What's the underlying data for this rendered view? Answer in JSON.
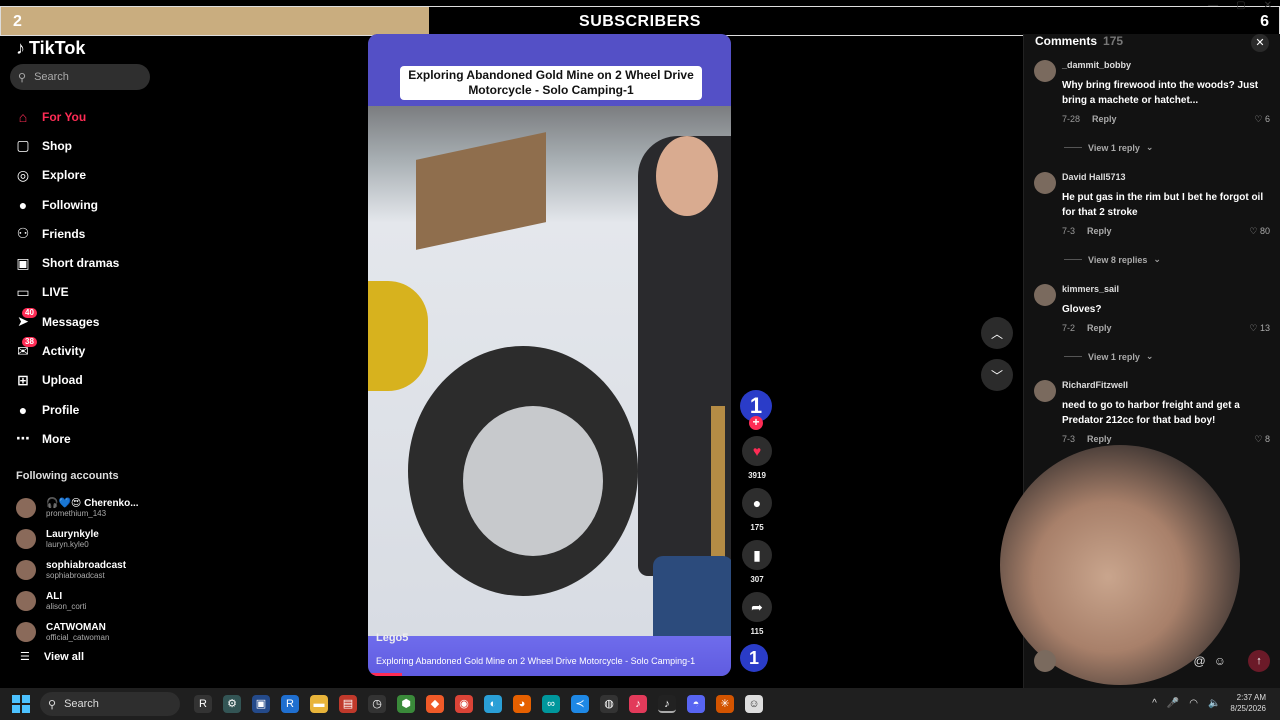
{
  "overlay": {
    "left_count": "2",
    "title": "SUBSCRIBERS",
    "right_count": "6",
    "progress_fraction": 0.335
  },
  "sidebar": {
    "logo": "TikTok",
    "search_placeholder": "Search",
    "nav": [
      {
        "label": "For You",
        "icon": "home-icon",
        "glyph": "⌂",
        "active": true
      },
      {
        "label": "Shop",
        "icon": "shopping-bag-icon",
        "glyph": "▢"
      },
      {
        "label": "Explore",
        "icon": "compass-icon",
        "glyph": "◎"
      },
      {
        "label": "Following",
        "icon": "avatar-icon",
        "glyph": "●"
      },
      {
        "label": "Friends",
        "icon": "friends-icon",
        "glyph": "⚇"
      },
      {
        "label": "Short dramas",
        "icon": "film-icon",
        "glyph": "▣"
      },
      {
        "label": "LIVE",
        "icon": "live-icon",
        "glyph": "▭"
      },
      {
        "label": "Messages",
        "icon": "send-icon",
        "glyph": "➤",
        "badge": "40"
      },
      {
        "label": "Activity",
        "icon": "inbox-icon",
        "glyph": "✉",
        "badge": "38"
      },
      {
        "label": "Upload",
        "icon": "plus-square-icon",
        "glyph": "⊞"
      },
      {
        "label": "Profile",
        "icon": "profile-avatar-icon",
        "glyph": "●"
      },
      {
        "label": "More",
        "icon": "more-dots-icon",
        "glyph": "⋯"
      }
    ],
    "following_title": "Following accounts",
    "following": [
      {
        "name": "🎧💙😍 Cherenko...",
        "handle": "promethium_143"
      },
      {
        "name": "Laurynkyle",
        "handle": "lauryn.kyle0"
      },
      {
        "name": "sophiabroadcast",
        "handle": "sophiabroadcast"
      },
      {
        "name": "ALI",
        "handle": "alison_corti"
      },
      {
        "name": "CATWOMAN",
        "handle": "official_catwoman"
      }
    ],
    "view_all": "View all"
  },
  "video": {
    "title_overlay": "Exploring Abandoned Gold Mine on 2 Wheel Drive Motorcycle - Solo Camping-1",
    "creator": "Lego5",
    "caption": "Exploring Abandoned Gold Mine on 2 Wheel Drive Motorcycle - Solo Camping-1",
    "avatar_glyph": "1",
    "likes": "3919",
    "comments": "175",
    "bookmarks": "307",
    "shares": "115",
    "accent": "#fe2c55"
  },
  "comments_panel": {
    "title": "Comments",
    "count": "175",
    "items": [
      {
        "user": "_dammit_bobby",
        "text": "Why bring firewood into the woods? Just bring a machete or hatchet...",
        "date": "7-28",
        "reply": "Reply",
        "likes": "6",
        "view_replies": "View 1 reply"
      },
      {
        "user": "David Hall5713",
        "text": "He put gas in the rim but I bet he forgot oil for that 2 stroke",
        "date": "7-3",
        "reply": "Reply",
        "likes": "80",
        "view_replies": "View 8 replies"
      },
      {
        "user": "kimmers_sail",
        "text": "Gloves?",
        "date": "7-2",
        "reply": "Reply",
        "likes": "13",
        "view_replies": "View 1 reply"
      },
      {
        "user": "RichardFitzwell",
        "text": "need to go to harbor freight and get a Predator 212cc for that bad boy!",
        "date": "7-3",
        "reply": "Reply",
        "likes": "8"
      }
    ]
  },
  "taskbar": {
    "search": "Search",
    "time": "2:37 AM",
    "date": "8/25/2026"
  }
}
